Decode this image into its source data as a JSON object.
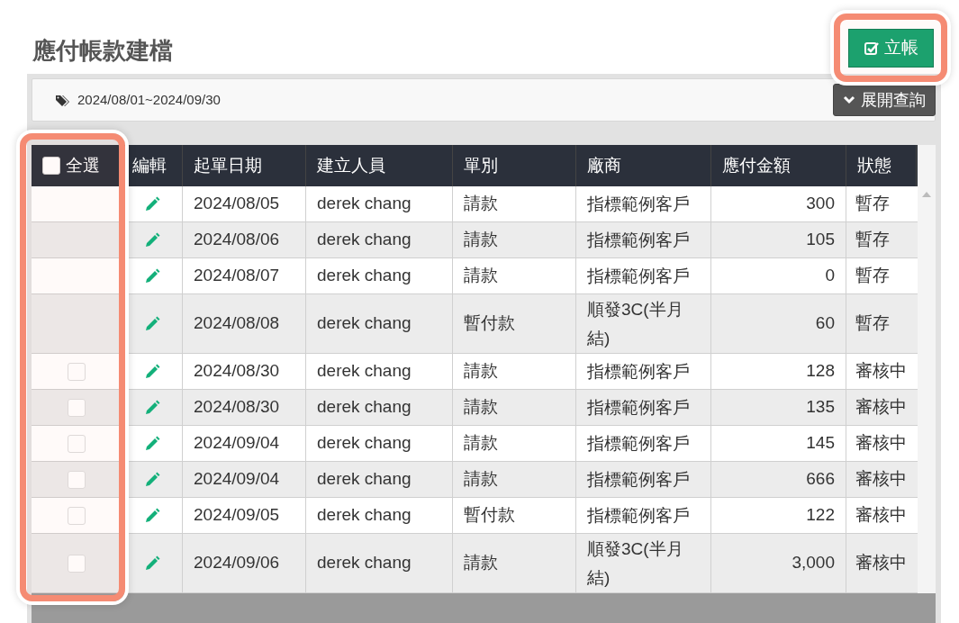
{
  "page_title": "應付帳款建檔",
  "create_button": {
    "label": "立帳",
    "highlighted": true
  },
  "filter": {
    "date_range": "2024/08/01~2024/09/30",
    "expand_button": "展開查詢"
  },
  "table": {
    "select_all": {
      "label": "全選",
      "checked": false,
      "highlighted": true
    },
    "columns": [
      "編輯",
      "起單日期",
      "建立人員",
      "單別",
      "廠商",
      "應付金額",
      "狀態"
    ],
    "rows": [
      {
        "checkbox": null,
        "date": "2024/08/05",
        "creator": "derek chang",
        "type": "請款",
        "vendor": "指標範例客戶",
        "amount": "300",
        "status": "暫存"
      },
      {
        "checkbox": null,
        "date": "2024/08/06",
        "creator": "derek chang",
        "type": "請款",
        "vendor": "指標範例客戶",
        "amount": "105",
        "status": "暫存"
      },
      {
        "checkbox": null,
        "date": "2024/08/07",
        "creator": "derek chang",
        "type": "請款",
        "vendor": "指標範例客戶",
        "amount": "0",
        "status": "暫存"
      },
      {
        "checkbox": null,
        "date": "2024/08/08",
        "creator": "derek chang",
        "type": "暫付款",
        "vendor": "順發3C(半月結)",
        "amount": "60",
        "status": "暫存"
      },
      {
        "checkbox": {
          "checked": false
        },
        "date": "2024/08/30",
        "creator": "derek chang",
        "type": "請款",
        "vendor": "指標範例客戶",
        "amount": "128",
        "status": "審核中"
      },
      {
        "checkbox": {
          "checked": false
        },
        "date": "2024/08/30",
        "creator": "derek chang",
        "type": "請款",
        "vendor": "指標範例客戶",
        "amount": "135",
        "status": "審核中"
      },
      {
        "checkbox": {
          "checked": false
        },
        "date": "2024/09/04",
        "creator": "derek chang",
        "type": "請款",
        "vendor": "指標範例客戶",
        "amount": "145",
        "status": "審核中"
      },
      {
        "checkbox": {
          "checked": false
        },
        "date": "2024/09/04",
        "creator": "derek chang",
        "type": "請款",
        "vendor": "指標範例客戶",
        "amount": "666",
        "status": "審核中"
      },
      {
        "checkbox": {
          "checked": false
        },
        "date": "2024/09/05",
        "creator": "derek chang",
        "type": "暫付款",
        "vendor": "指標範例客戶",
        "amount": "122",
        "status": "審核中"
      },
      {
        "checkbox": {
          "checked": false
        },
        "date": "2024/09/06",
        "creator": "derek chang",
        "type": "請款",
        "vendor": "順發3C(半月結)",
        "amount": "3,000",
        "status": "審核中"
      }
    ]
  }
}
